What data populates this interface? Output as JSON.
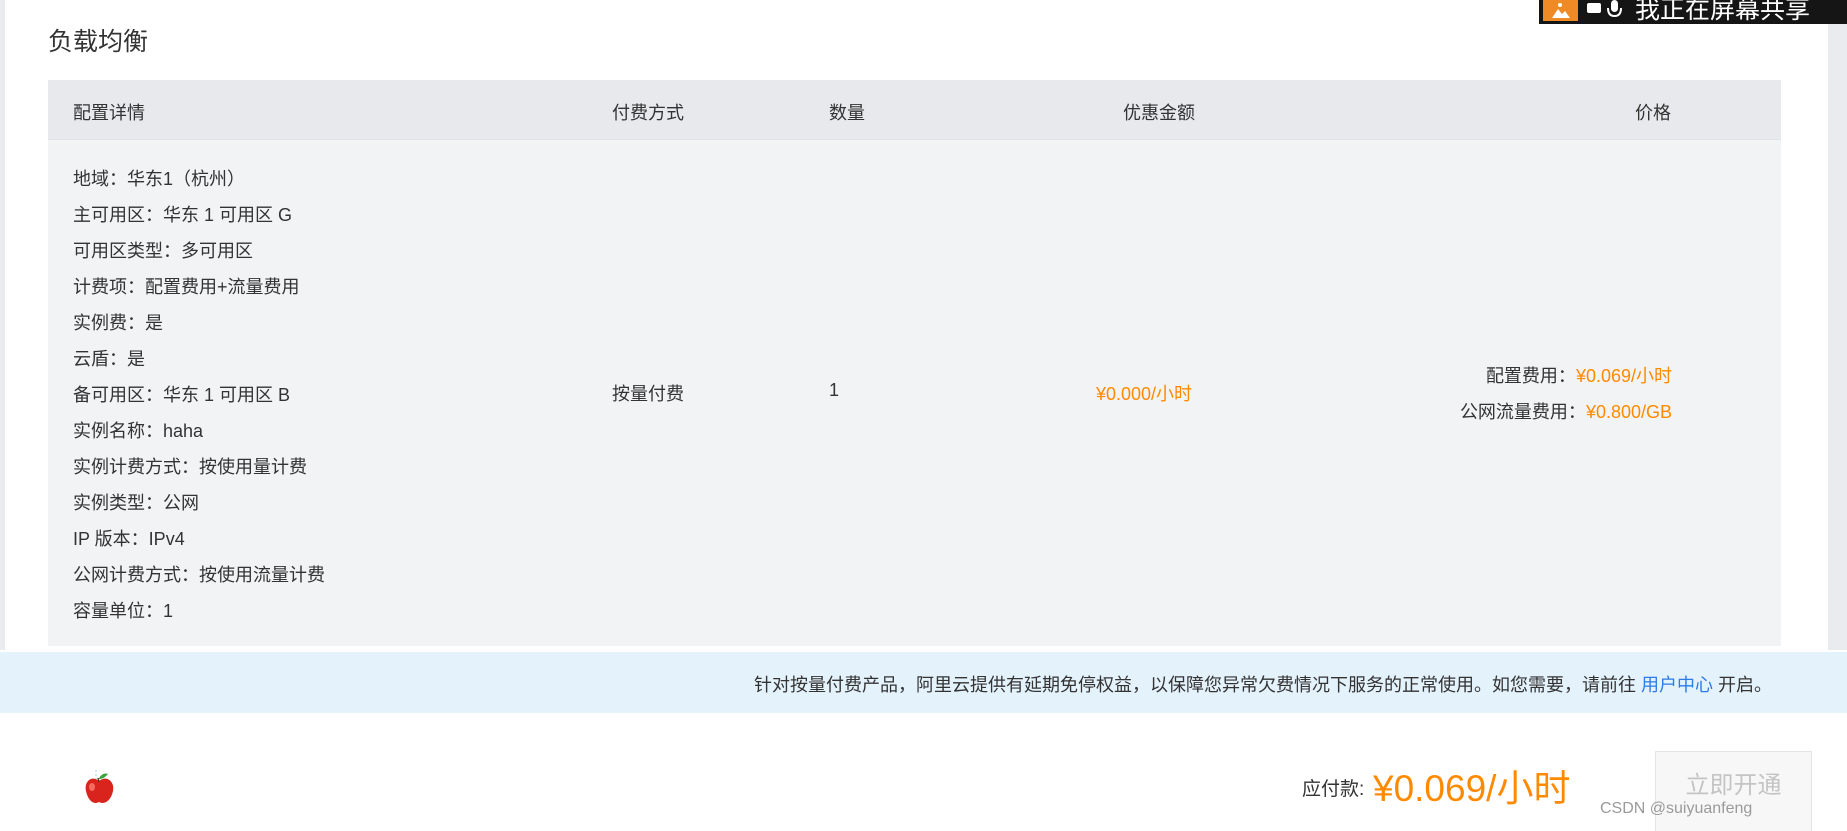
{
  "section": {
    "title": "负载均衡"
  },
  "table": {
    "headers": [
      "配置详情",
      "付费方式",
      "数量",
      "优惠金额",
      "价格"
    ],
    "details": [
      "地域：华东1（杭州）",
      "主可用区：华东 1 可用区 G",
      "可用区类型：多可用区",
      "计费项：配置费用+流量费用",
      "实例费：是",
      "云盾：是",
      "备可用区：华东 1 可用区 B",
      "实例名称：haha",
      "实例计费方式：按使用量计费",
      "实例类型：公网",
      "IP 版本：IPv4",
      "公网计费方式：按使用流量计费",
      "容量单位：1"
    ],
    "payment_method": "按量付费",
    "quantity": "1",
    "discount": "¥0.000/小时",
    "price": {
      "config_label": "配置费用：",
      "config_value": "¥0.069/小时",
      "traffic_label": "公网流量费用：",
      "traffic_value": "¥0.800/GB"
    }
  },
  "notice": {
    "text": "针对按量付费产品，阿里云提供有延期免停权益，以保障您异常欠费情况下服务的正常使用。如您需要，请前往",
    "link": "用户中心",
    "suffix": " 开启。"
  },
  "footer": {
    "pay_label": "应付款:",
    "pay_amount": "¥0.069/小时",
    "submit_label": "立即开通",
    "watermark": "CSDN @suiyuanfeng"
  },
  "share_bar": {
    "text": "我正在屏幕共享"
  },
  "colors": {
    "accent_orange": "#ff8a00",
    "link_blue": "#2d7be6",
    "notice_bg": "#e4f2fc",
    "table_bg": "#f2f3f5",
    "header_bg": "#e7e9ed"
  },
  "icons": [
    "apple-icon",
    "share-icon",
    "mic-icon"
  ]
}
